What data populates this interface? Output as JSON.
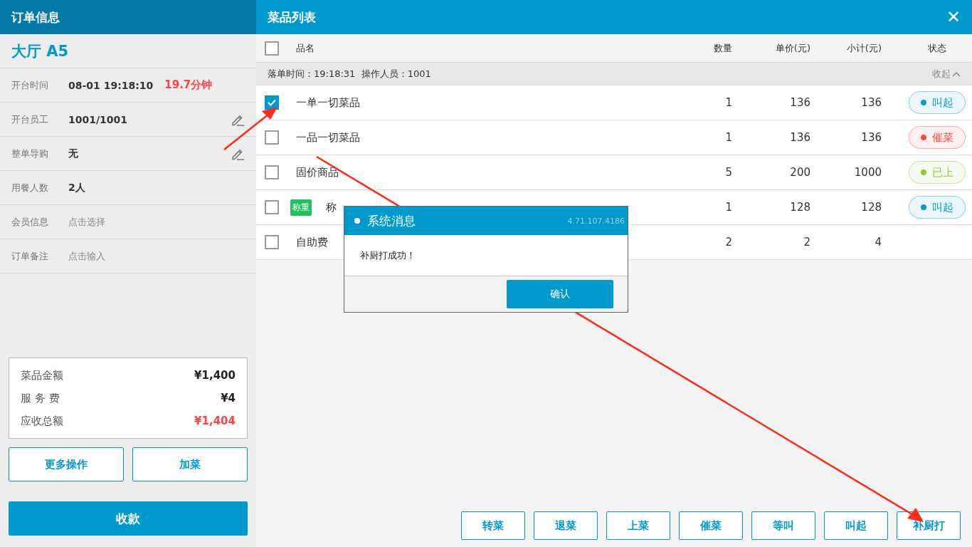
{
  "order_panel": {
    "title": "订单信息",
    "table_name": "大厅 A5",
    "fields": [
      {
        "label": "开台时间",
        "value": "08-01 19:18:10",
        "extra": "19.7分钟",
        "editable": false
      },
      {
        "label": "开台员工",
        "value": "1001/1001",
        "editable": true
      },
      {
        "label": "整单导购",
        "value": "无",
        "editable": true
      },
      {
        "label": "用餐人数",
        "value": "2人",
        "editable": false
      },
      {
        "label": "会员信息",
        "placeholder": "点击选择",
        "editable": false
      },
      {
        "label": "订单备注",
        "placeholder": "点击输入",
        "editable": false
      }
    ],
    "summary": [
      {
        "label": "菜品金额",
        "amount": "¥1,400",
        "highlight": false
      },
      {
        "label": "服 务 费",
        "amount": "¥4",
        "highlight": false
      },
      {
        "label": "应收总额",
        "amount": "¥1,404",
        "highlight": true
      }
    ],
    "buttons": [
      "更多操作",
      "加菜"
    ],
    "pay_button": "收款"
  },
  "dish_panel": {
    "title": "菜品列表",
    "close": "✕",
    "columns": [
      "品名",
      "数量",
      "单价(元)",
      "小计(元)",
      "状态"
    ],
    "select_all": false,
    "group": {
      "info": "落单时间：19:18:31  操作人员：1001",
      "collapse": "收起"
    },
    "rows": [
      {
        "checked": true,
        "name": "一单一切菜品",
        "qty": "1",
        "price": "136",
        "subtotal": "136",
        "status": {
          "label": "叫起",
          "color": "#0099cc"
        }
      },
      {
        "checked": false,
        "name": "一品一切菜品",
        "qty": "1",
        "price": "136",
        "subtotal": "136",
        "status": {
          "label": "催菜",
          "color": "#ff4444"
        }
      },
      {
        "checked": false,
        "name": "固价商品",
        "qty": "5",
        "price": "200",
        "subtotal": "1000",
        "status": {
          "label": "已上",
          "color": "#88cc33"
        }
      },
      {
        "checked": false,
        "tag": "称重",
        "name": "称",
        "qty": "1",
        "price": "128",
        "subtotal": "128",
        "status": {
          "label": "叫起",
          "color": "#0099cc"
        }
      },
      {
        "checked": false,
        "name": "自助费",
        "qty": "2",
        "price": "2",
        "subtotal": "4"
      }
    ],
    "actions": [
      "转菜",
      "退菜",
      "上菜",
      "催菜",
      "等叫",
      "叫起",
      "补厨打"
    ]
  },
  "dialog": {
    "title": "系统消息",
    "version": "4.71.107.4186",
    "message": "补厨打成功！",
    "confirm": "确认"
  }
}
